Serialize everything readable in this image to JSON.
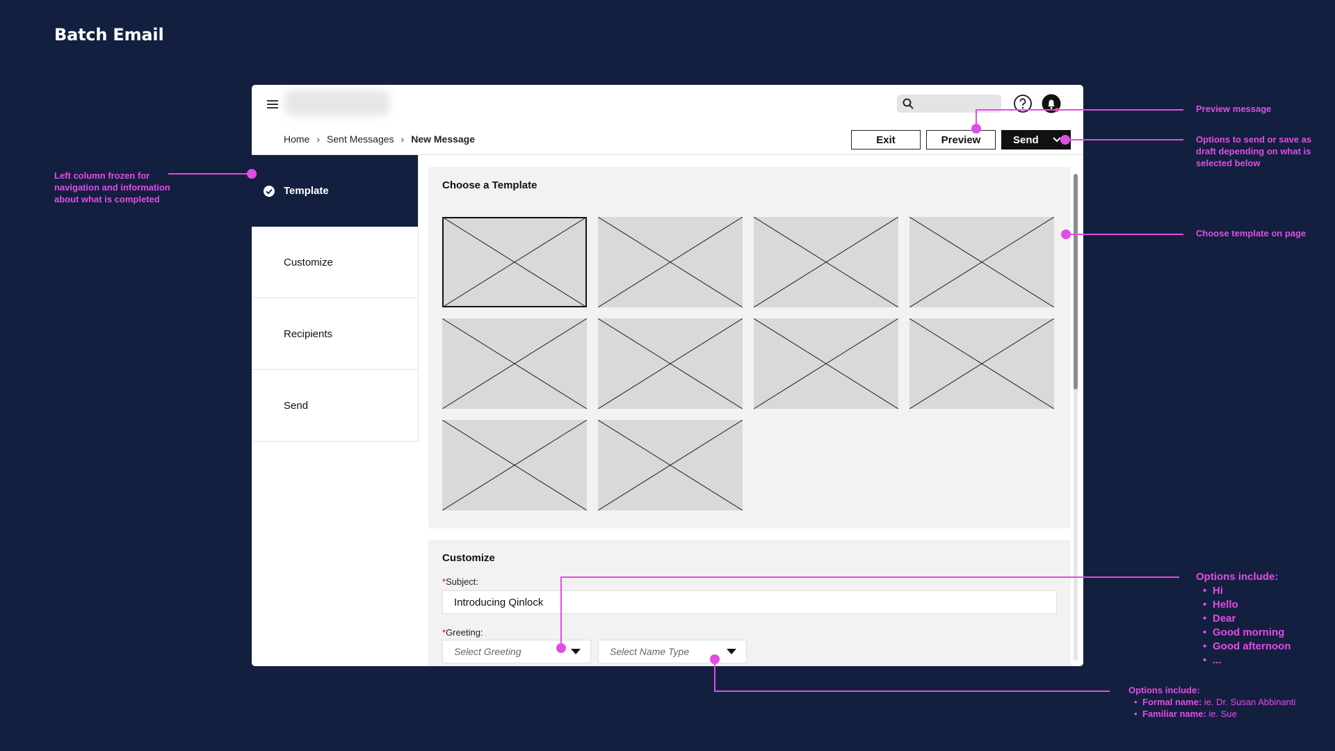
{
  "page": {
    "title": "Batch Email"
  },
  "header": {
    "breadcrumb": [
      "Home",
      "Sent Messages",
      "New Message"
    ],
    "buttons": {
      "exit": "Exit",
      "preview": "Preview",
      "send": "Send"
    }
  },
  "sidebar": {
    "items": [
      {
        "label": "Template",
        "active": true,
        "completed": true
      },
      {
        "label": "Customize"
      },
      {
        "label": "Recipients"
      },
      {
        "label": "Send"
      }
    ]
  },
  "templates": {
    "title": "Choose a Template",
    "count": 10,
    "selected_index": 0
  },
  "customize": {
    "title": "Customize",
    "required_mark": "*",
    "subject_label": "Subject:",
    "subject_value": "Introducing Qinlock",
    "greeting_label": "Greeting:",
    "greeting_placeholder": "Select Greeting",
    "name_type_placeholder": "Select Name Type"
  },
  "annotations": {
    "left_column": "Left column frozen for navigation and information about what is completed",
    "preview": "Preview message",
    "send_options": "Options to send or save as draft depending on what is selected below",
    "choose_template": "Choose template on page",
    "greeting_options_title": "Options include:",
    "greeting_options": [
      "Hi",
      "Hello",
      "Dear",
      "Good morning",
      "Good afternoon",
      "..."
    ],
    "name_options_title": "Options include:",
    "name_options": [
      {
        "label": "Formal name:",
        "example": "ie. Dr. Susan Abbinanti"
      },
      {
        "label": "Familiar name:",
        "example": "ie. Sue"
      }
    ]
  },
  "colors": {
    "background": "#131f3f",
    "annotation": "#e14de4",
    "active_nav": "#131f3f"
  }
}
